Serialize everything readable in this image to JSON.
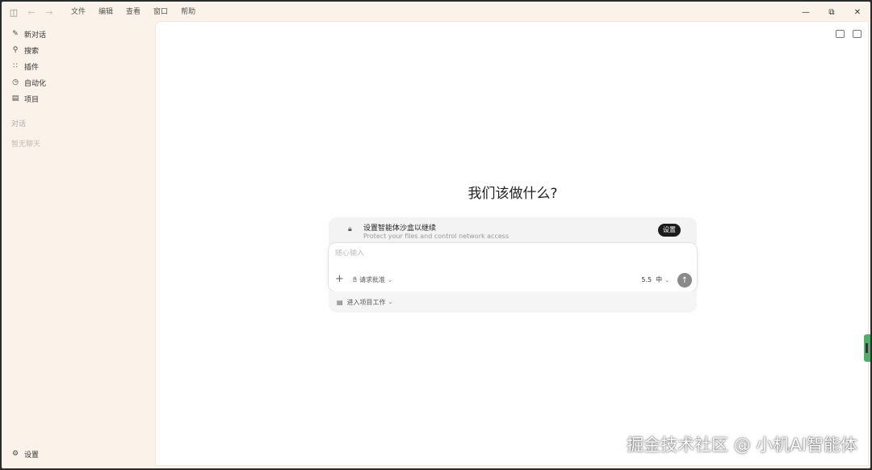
{
  "titlebar": {
    "menu": [
      "文件",
      "编辑",
      "查看",
      "窗口",
      "帮助"
    ],
    "icons": [
      "sidebar-toggle-icon",
      "back-arrow-icon",
      "forward-arrow-icon"
    ],
    "window_controls": [
      "minimize-icon",
      "restore-icon",
      "close-icon"
    ]
  },
  "sidebar": {
    "items": [
      {
        "label": "新对话",
        "icon": "new-chat-icon"
      },
      {
        "label": "搜索",
        "icon": "search-icon"
      },
      {
        "label": "插件",
        "icon": "plugins-icon"
      },
      {
        "label": "自动化",
        "icon": "clock-icon"
      },
      {
        "label": "项目",
        "icon": "folder-icon"
      }
    ],
    "section_label": "对话",
    "empty_label": "暂无聊天",
    "settings_label": "设置"
  },
  "main": {
    "headline": "我们该做什么?",
    "sandbox": {
      "title": "设置智能体沙盒以继续",
      "subtitle": "Protect your files and control network access",
      "button": "设置"
    },
    "composer": {
      "placeholder": "随心输入",
      "approval_label": "请求批准",
      "model": "5.5",
      "effort": "中"
    },
    "project_label": "进入项目工作"
  },
  "watermark": "掘金技术社区 @ 小机AI智能体"
}
